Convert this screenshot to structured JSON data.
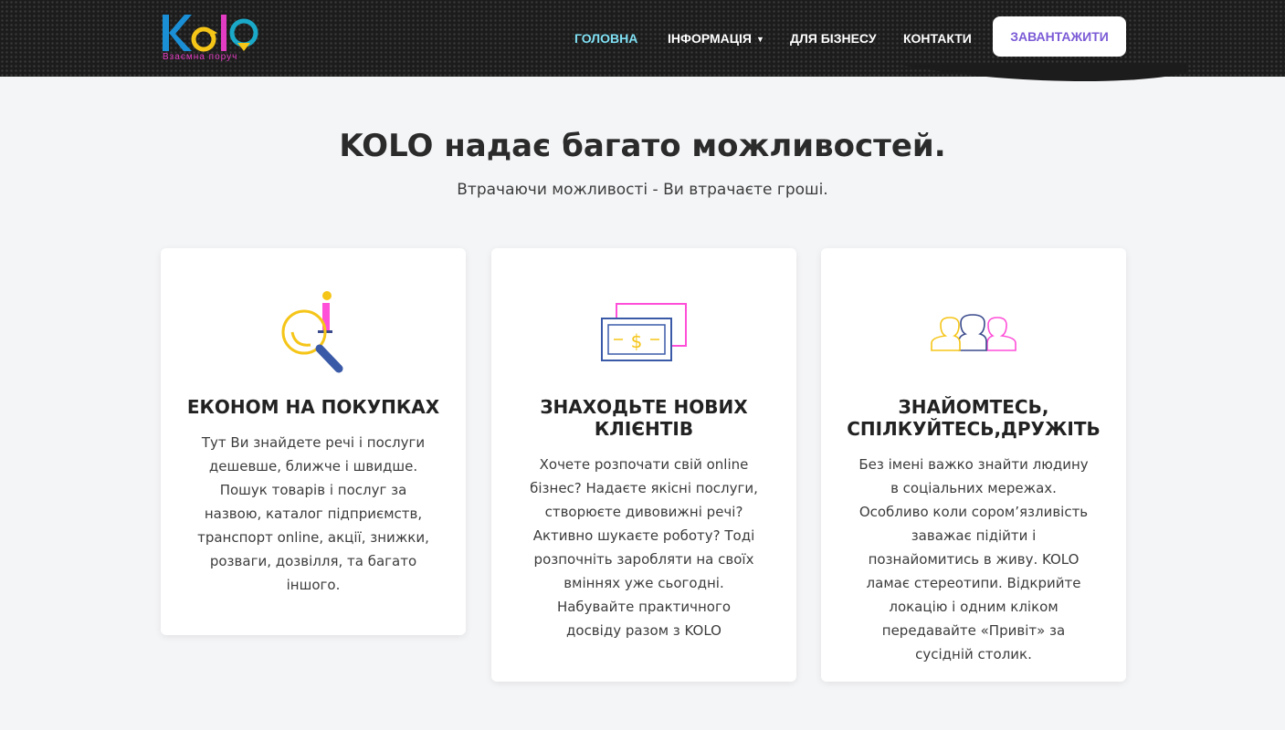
{
  "header": {
    "logo_tagline": "Bзаємна поруч",
    "nav": [
      {
        "label": "ГОЛОВНА",
        "active": true
      },
      {
        "label": "ІНФОРМАЦІЯ",
        "has_dropdown": true
      },
      {
        "label": "ДЛЯ БІЗНЕСУ"
      },
      {
        "label": "КОНТАКТИ"
      }
    ],
    "download_label": "ЗАВАНТАЖИТИ"
  },
  "section": {
    "title": "KOLO надає багато можливостей.",
    "subtitle": "Втрачаючи можливості - Ви втрачаєте гроші."
  },
  "cards": [
    {
      "icon": "search-info-icon",
      "title": "ЕКОНОМ НА ПОКУПКАХ",
      "text": "Тут Ви знайдете речі і послуги дешевше, ближче і швидше. Пошук товарів і послуг за назвою, каталог підприємств, транспорт online, акції, знижки, розваги, дозвілля, та багато іншого."
    },
    {
      "icon": "money-bill-icon",
      "title": "ЗНАХОДЬТЕ НОВИХ КЛІЄНТІВ",
      "text": "Хочете розпочати свій online бізнес? Надаєте якісні послуги, створюєте дивовижні речі? Активно шукаєте роботу? Тоді розпочніть заробляти на своїх вміннях уже сьогодні. Набувайте практичного досвіду разом з KOLO"
    },
    {
      "icon": "people-group-icon",
      "title": "ЗНАЙОМТЕСЬ, СПІЛКУЙТЕСЬ,ДРУЖІТЬ",
      "text": "Без імені важко знайти людину в соціальних мережах. Особливо коли сором’язливість заважає підійти і познайомитись в живу. KOLO ламає стереотипи. Відкрийте локацію і одним кліком передавайте «Привіт» за сусідній столик."
    }
  ],
  "colors": {
    "accent_cyan": "#7fe0f3",
    "accent_purple": "#7b5bd6",
    "logo_blue": "#1a8fd6",
    "logo_yellow": "#f5c518",
    "logo_pink": "#e23cc2"
  }
}
